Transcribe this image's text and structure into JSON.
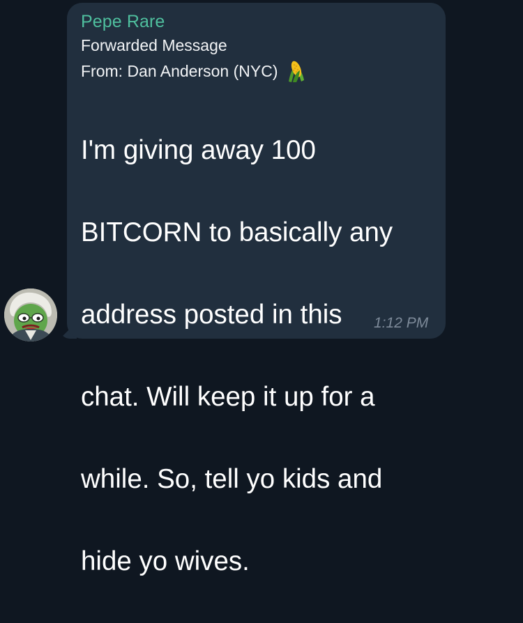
{
  "message": {
    "sender_name": "Pepe Rare",
    "forwarded_label": "Forwarded Message",
    "forwarded_from": "From: Dan Anderson (NYC)",
    "forwarded_from_icon": "corn-emoji",
    "text_lines": [
      "I'm giving away 100",
      "BITCORN to basically any",
      "address posted in this",
      "chat. Will keep it up for a",
      "while. So, tell yo kids and",
      "hide yo wives."
    ],
    "time": "1:12 PM"
  },
  "colors": {
    "background": "#0f1721",
    "bubble": "#212f3e",
    "sender_name": "#4fbf9e",
    "text": "#ffffff",
    "timestamp": "#7d8a99"
  },
  "avatar": {
    "icon": "pepe-avatar-icon"
  }
}
